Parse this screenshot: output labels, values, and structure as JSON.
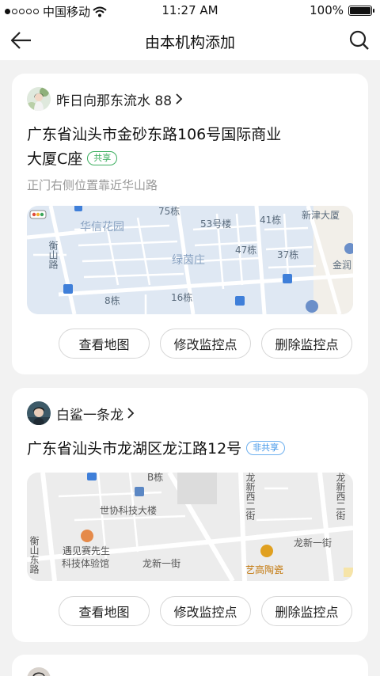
{
  "status_bar": {
    "carrier": "中国移动",
    "time": "11:27 AM",
    "battery": "100%"
  },
  "nav": {
    "title": "由本机构添加"
  },
  "cards": [
    {
      "owner": "昨日向那东流水 88",
      "address_line1": "广东省汕头市金砂东路106号国际商业",
      "address_line2": "大厦C座",
      "share_tag": "共享",
      "note": "正门右侧位置靠近华山路",
      "map_labels": [
        "75栋",
        "53号楼",
        "41栋",
        "新津大厦",
        "华信花园",
        "衡山路",
        "绿茵庄",
        "47栋",
        "37栋",
        "金润",
        "8栋",
        "16栋"
      ],
      "buttons": [
        "查看地图",
        "修改监控点",
        "删除监控点"
      ]
    },
    {
      "owner": "白鲨一条龙",
      "address_line1": "广东省汕头市龙湖区龙江路12号",
      "share_tag": "非共享",
      "map_labels": [
        "B栋",
        "世协科技大楼",
        "龙新西二街",
        "龙新西二街",
        "遇见赛先生",
        "科技体验馆",
        "衡山东路",
        "龙新一街",
        "龙新一街",
        "艺高陶瓷"
      ],
      "buttons": [
        "查看地图",
        "修改监控点",
        "删除监控点"
      ]
    }
  ],
  "colors": {
    "map1_bg": "#dfe8f3",
    "map2_bg": "#ececec",
    "share_green": "#3cae5f",
    "unshare_blue": "#3f95e8"
  }
}
